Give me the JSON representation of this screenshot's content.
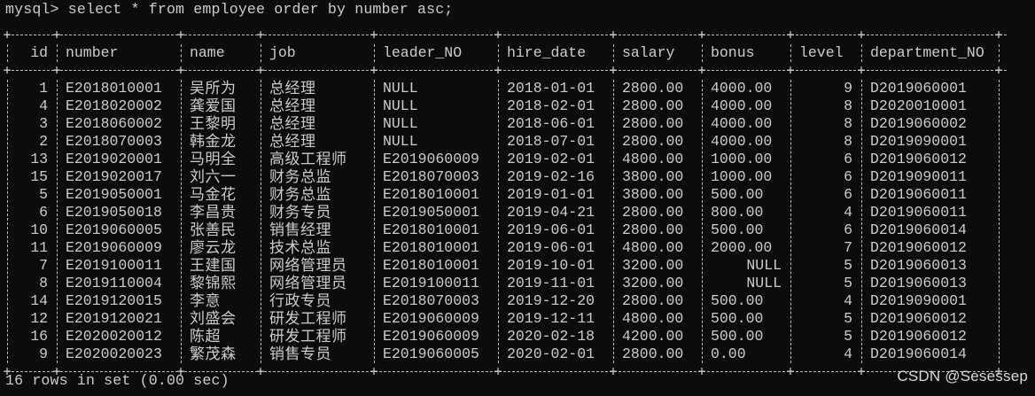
{
  "terminal": {
    "prompt": "mysql>",
    "command": "select * from employee order by number asc;",
    "footer": "16 rows in set (0.00 sec)"
  },
  "watermark": "CSDN @Sesessep",
  "table": {
    "columns": [
      "id",
      "number",
      "name",
      "job",
      "leader_NO",
      "hire_date",
      "salary",
      "bonus",
      "level",
      "department_NO"
    ],
    "rows": [
      [
        "1",
        "E2018010001",
        "吴所为",
        "总经理",
        "NULL",
        "2018-01-01",
        "2800.00",
        "4000.00",
        "9",
        "D2019060001"
      ],
      [
        "4",
        "E2018020002",
        "龚爱国",
        "总经理",
        "NULL",
        "2018-02-01",
        "2800.00",
        "4000.00",
        "8",
        "D2020010001"
      ],
      [
        "3",
        "E2018060002",
        "王黎明",
        "总经理",
        "NULL",
        "2018-06-01",
        "2800.00",
        "4000.00",
        "8",
        "D2019060002"
      ],
      [
        "2",
        "E2018070003",
        "韩金龙",
        "总经理",
        "NULL",
        "2018-07-01",
        "2800.00",
        "4000.00",
        "8",
        "D2019090001"
      ],
      [
        "13",
        "E2019020001",
        "马明全",
        "高级工程师",
        "E2019060009",
        "2019-02-01",
        "4800.00",
        "1000.00",
        "6",
        "D2019060012"
      ],
      [
        "15",
        "E2019020017",
        "刘六一",
        "财务总监",
        "E2018070003",
        "2019-02-16",
        "3800.00",
        "1000.00",
        "6",
        "D2019090011"
      ],
      [
        "5",
        "E2019050001",
        "马金花",
        "财务总监",
        "E2018010001",
        "2019-01-01",
        "3800.00",
        "500.00",
        "6",
        "D2019060011"
      ],
      [
        "6",
        "E2019050018",
        "李昌贵",
        "财务专员",
        "E2019050001",
        "2019-04-21",
        "2800.00",
        "800.00",
        "4",
        "D2019060011"
      ],
      [
        "10",
        "E2019060005",
        "张善民",
        "销售经理",
        "E2018010001",
        "2019-06-01",
        "2800.00",
        "500.00",
        "6",
        "D2019060014"
      ],
      [
        "11",
        "E2019060009",
        "廖云龙",
        "技术总监",
        "E2018010001",
        "2019-06-01",
        "4800.00",
        "2000.00",
        "7",
        "D2019060012"
      ],
      [
        "7",
        "E2019100011",
        "王建国",
        "网络管理员",
        "E2018010001",
        "2019-10-01",
        "3200.00",
        "NULL",
        "5",
        "D2019060013"
      ],
      [
        "8",
        "E2019110004",
        "黎锦熙",
        "网络管理员",
        "E2019100011",
        "2019-11-01",
        "3200.00",
        "NULL",
        "5",
        "D2019060013"
      ],
      [
        "14",
        "E2019120015",
        "李意",
        "行政专员",
        "E2018070003",
        "2019-12-20",
        "2800.00",
        "500.00",
        "4",
        "D2019090001"
      ],
      [
        "12",
        "E2019120021",
        "刘盛会",
        "研发工程师",
        "E2019060009",
        "2019-12-11",
        "4800.00",
        "500.00",
        "5",
        "D2019060012"
      ],
      [
        "16",
        "E2020020012",
        "陈超",
        "研发工程师",
        "E2019060009",
        "2020-02-18",
        "4200.00",
        "500.00",
        "5",
        "D2019060012"
      ],
      [
        "9",
        "E2020020023",
        "繁茂森",
        "销售专员",
        "E2019060005",
        "2020-02-01",
        "2800.00",
        "0.00",
        "4",
        "D2019060014"
      ]
    ]
  }
}
